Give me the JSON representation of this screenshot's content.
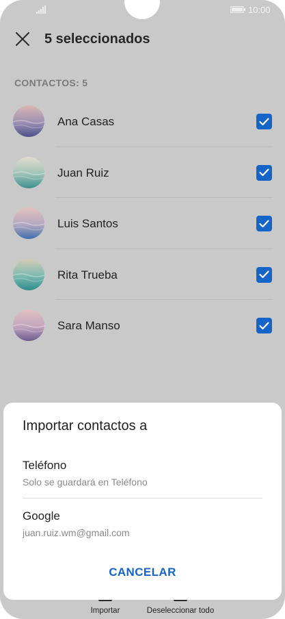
{
  "status_bar": {
    "time": "10:00"
  },
  "header": {
    "title": "5 seleccionados",
    "close_icon": "close-icon"
  },
  "section": {
    "label": "CONTACTOS: 5"
  },
  "contacts": [
    {
      "name": "Ana Casas",
      "checked": true,
      "avatar_colors": [
        "#d9b7b3",
        "#9b8fb2",
        "#4d4f8a"
      ]
    },
    {
      "name": "Juan Ruiz",
      "checked": true,
      "avatar_colors": [
        "#e6dccf",
        "#9cc2b6",
        "#3d8f8f"
      ]
    },
    {
      "name": "Luis Santos",
      "checked": true,
      "avatar_colors": [
        "#e4c2bd",
        "#b3a7c0",
        "#3f6fae"
      ]
    },
    {
      "name": "Rita Trueba",
      "checked": true,
      "avatar_colors": [
        "#d5cdb4",
        "#7cb9b1",
        "#2e8d8c"
      ]
    },
    {
      "name": "Sara Manso",
      "checked": true,
      "avatar_colors": [
        "#e2c0c1",
        "#c2a5bd",
        "#6c5b8e"
      ]
    }
  ],
  "sheet": {
    "title": "Importar contactos a",
    "options": [
      {
        "title": "Teléfono",
        "subtitle": "Solo se guardará en Teléfono"
      },
      {
        "title": "Google",
        "subtitle": "juan.ruiz.wm@gmail.com"
      }
    ],
    "cancel_label": "CANCELAR"
  },
  "bottom_bar": {
    "import_label": "Importar",
    "deselect_label": "Deseleccionar todo"
  },
  "colors": {
    "accent": "#1565c8",
    "dim_background": "#c9c9c9"
  }
}
